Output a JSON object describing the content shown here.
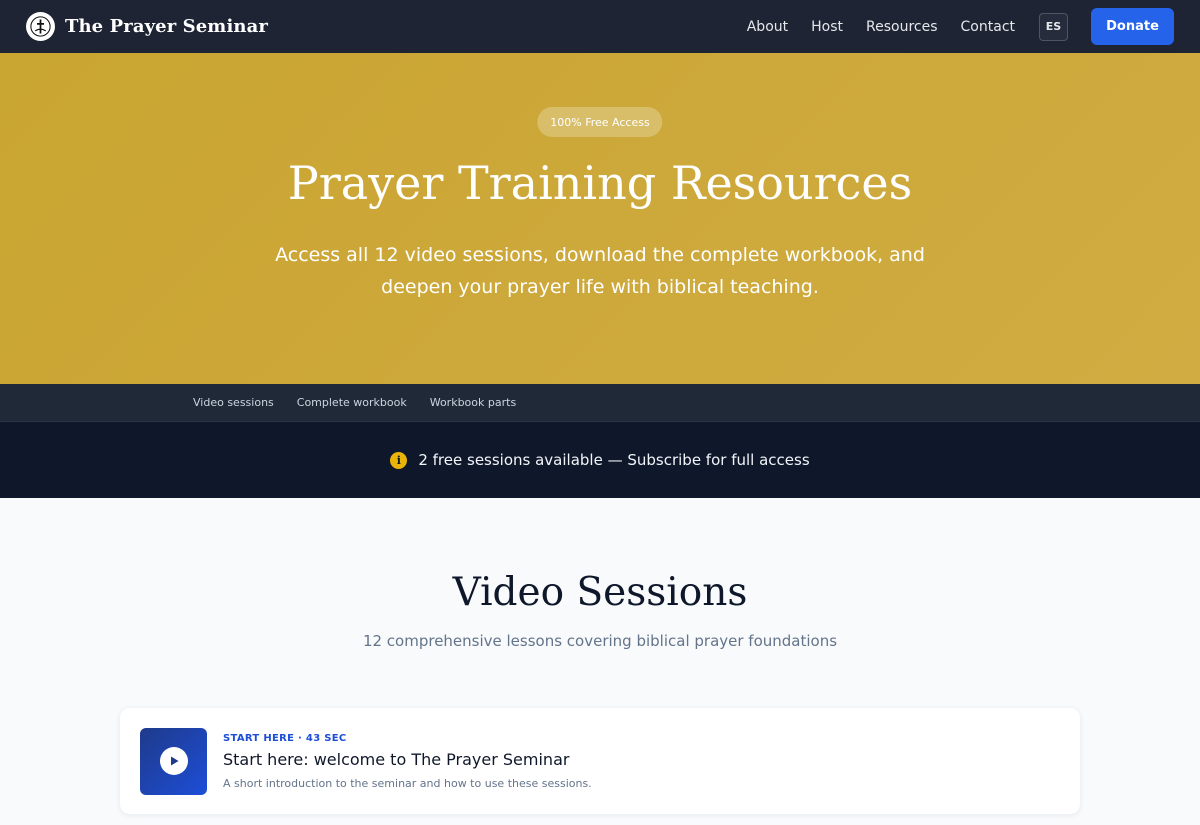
{
  "nav": {
    "brand": "The Prayer Seminar",
    "links": [
      "About",
      "Host",
      "Resources",
      "Contact"
    ],
    "lang": "ES",
    "donate": "Donate"
  },
  "hero": {
    "badge": "100% Free Access",
    "title": "Prayer Training Resources",
    "subtitle_line1": "Access all 12 video sessions, download the complete workbook, and",
    "subtitle_line2": "deepen your prayer life with biblical teaching."
  },
  "subnav": [
    "Video sessions",
    "Complete workbook",
    "Workbook parts"
  ],
  "banner": {
    "icon": "info-icon",
    "text": "2 free sessions available — Subscribe for full access"
  },
  "sessions": {
    "title": "Video Sessions",
    "subtitle": "12 comprehensive lessons covering biblical prayer foundations",
    "items": [
      {
        "meta": "START HERE · 43 SEC",
        "title": "Start here: welcome to The Prayer Seminar",
        "description": "A short introduction to the seminar and how to use these sessions."
      }
    ]
  },
  "colors": {
    "nav_bg": "#1e2433",
    "hero_gold": "#cda83a",
    "donate": "#2563eb",
    "banner_bg": "#0f172a",
    "accent_blue": "#1d4ed8"
  }
}
